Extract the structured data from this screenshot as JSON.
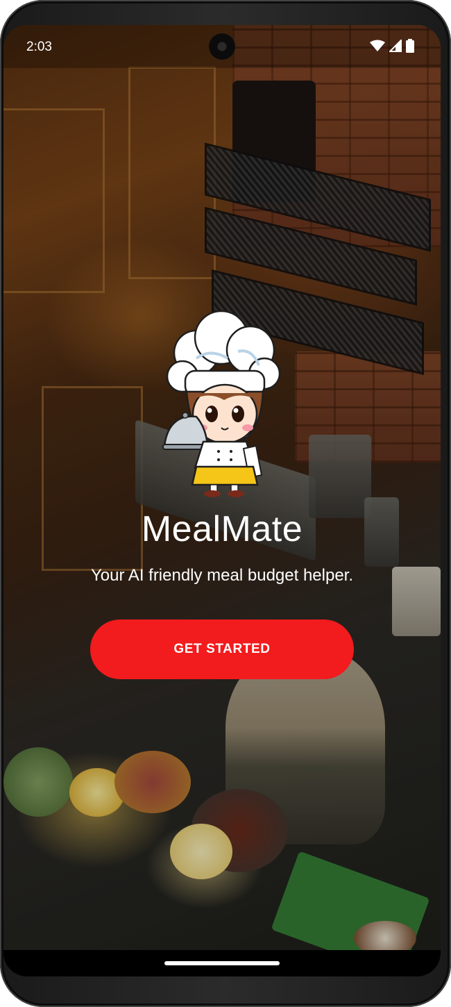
{
  "status_bar": {
    "time": "2:03"
  },
  "app": {
    "title": "MealMate",
    "tagline": "Your AI friendly meal budget helper."
  },
  "actions": {
    "get_started_label": "GET STARTED"
  },
  "colors": {
    "primary_button": "#f21b1d",
    "text": "#ffffff"
  },
  "icons": [
    "wifi-icon",
    "cellular-signal-icon",
    "battery-icon",
    "chef-mascot-illustration"
  ]
}
